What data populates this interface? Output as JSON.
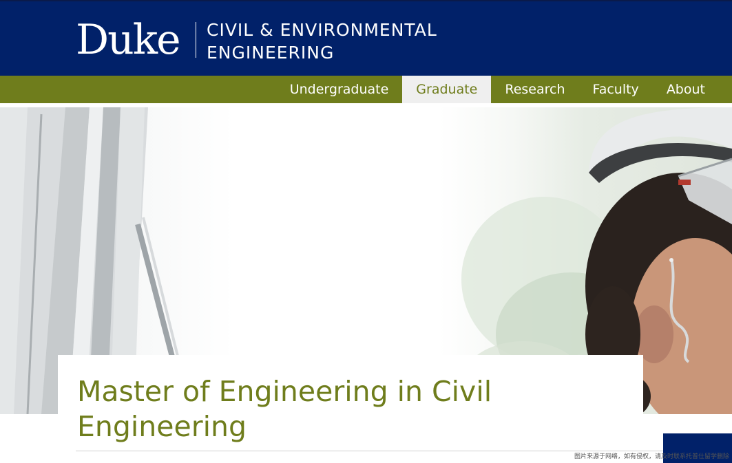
{
  "header": {
    "logo_text": "Duke",
    "dept_line1": "CIVIL & ENVIRONMENTAL",
    "dept_line2": "ENGINEERING"
  },
  "nav": {
    "items": [
      {
        "label": "Undergraduate",
        "active": false
      },
      {
        "label": "Graduate",
        "active": true
      },
      {
        "label": "Research",
        "active": false
      },
      {
        "label": "Faculty",
        "active": false
      },
      {
        "label": "About",
        "active": false
      }
    ]
  },
  "hero": {
    "image_name": "hero-photo-engineer-hard-hat"
  },
  "page": {
    "title": "Master of Engineering in Civil Engineering"
  },
  "watermark": {
    "text": "图片来源于网络，如有侵权，请及时联系托普仕留学删除"
  },
  "colors": {
    "duke_blue": "#012169",
    "olive": "#6f7d1c",
    "nav_active_bg": "#efefef"
  }
}
